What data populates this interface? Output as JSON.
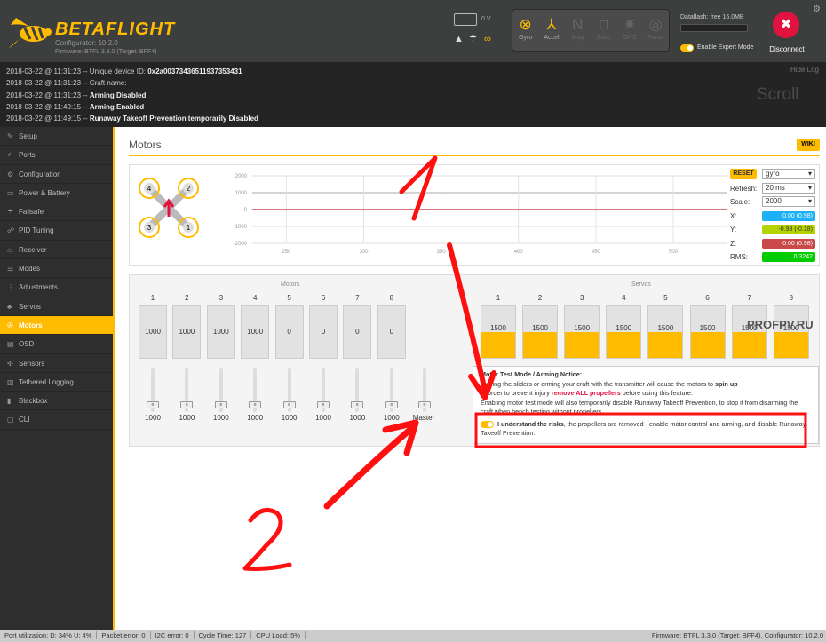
{
  "header": {
    "brand": "BETAFLIGHT",
    "configurator": "Configurator: 10.2.0",
    "firmware": "Firmware: BTFL 3.3.0 (Target: BFF4)",
    "battery_voltage": "0 V",
    "sensors": [
      {
        "label": "Gyro",
        "icon": "gyro-icon",
        "active": true
      },
      {
        "label": "Accel",
        "icon": "accel-icon",
        "active": true
      },
      {
        "label": "Mag",
        "icon": "mag-icon",
        "active": false
      },
      {
        "label": "Baro",
        "icon": "baro-icon",
        "active": false
      },
      {
        "label": "GPS",
        "icon": "gps-icon",
        "active": false
      },
      {
        "label": "Sonar",
        "icon": "sonar-icon",
        "active": false
      }
    ],
    "dataflash": "Dataflash: free 16.0MB",
    "expert_mode": "Enable Expert Mode",
    "disconnect": "Disconnect"
  },
  "log": {
    "hide": "Hide Log",
    "scroll": "Scroll",
    "lines": [
      {
        "prefix": "2018-03-22 @ 11:31:23 -- Unique device ID: ",
        "bold": "0x2a00373436511937353431"
      },
      {
        "prefix": "2018-03-22 @ 11:31:23 -- Craft name:",
        "bold": ""
      },
      {
        "prefix": "2018-03-22 @ 11:31:23 -- ",
        "bold": "Arming Disabled"
      },
      {
        "prefix": "2018-03-22 @ 11:49:15 -- ",
        "bold": "Arming Enabled"
      },
      {
        "prefix": "2018-03-22 @ 11:49:15 -- ",
        "bold": "Runaway Takeoff Prevention temporarily Disabled"
      }
    ]
  },
  "sidebar": {
    "items": [
      {
        "label": "Setup",
        "icon": "wrench-icon",
        "glyph": "✎"
      },
      {
        "label": "Ports",
        "icon": "plug-icon",
        "glyph": "⚡"
      },
      {
        "label": "Configuration",
        "icon": "gear-icon",
        "glyph": "⚙"
      },
      {
        "label": "Power & Battery",
        "icon": "battery-icon",
        "glyph": "▭"
      },
      {
        "label": "Failsafe",
        "icon": "failsafe-icon",
        "glyph": "☂"
      },
      {
        "label": "PID Tuning",
        "icon": "pid-icon",
        "glyph": "☍"
      },
      {
        "label": "Receiver",
        "icon": "receiver-icon",
        "glyph": "⌂"
      },
      {
        "label": "Modes",
        "icon": "modes-icon",
        "glyph": "☰"
      },
      {
        "label": "Adjustments",
        "icon": "adjustments-icon",
        "glyph": "⋮"
      },
      {
        "label": "Servos",
        "icon": "servo-icon",
        "glyph": "♣"
      },
      {
        "label": "Motors",
        "icon": "motor-icon",
        "glyph": "✇",
        "active": true
      },
      {
        "label": "OSD",
        "icon": "osd-icon",
        "glyph": "▤"
      },
      {
        "label": "Sensors",
        "icon": "sensors-icon",
        "glyph": "✣"
      },
      {
        "label": "Tethered Logging",
        "icon": "tethered-icon",
        "glyph": "▥"
      },
      {
        "label": "Blackbox",
        "icon": "blackbox-icon",
        "glyph": "▮"
      },
      {
        "label": "CLI",
        "icon": "cli-icon",
        "glyph": "▢"
      }
    ]
  },
  "main": {
    "title": "Motors",
    "wiki": "WIKI",
    "quad_motors": [
      "4",
      "2",
      "3",
      "1"
    ],
    "graph": {
      "y_ticks": [
        "2000",
        "1000",
        "0",
        "-1000",
        "-2000"
      ],
      "x_ticks": [
        "250",
        "300",
        "350",
        "400",
        "450",
        "500"
      ],
      "x_values": [
        250,
        300,
        350,
        400,
        450,
        500
      ],
      "x_range": [
        228,
        535
      ],
      "y_range": [
        -2000,
        2000
      ]
    },
    "controls": {
      "reset": "RESET",
      "sensor": "gyro",
      "refresh_label": "Refresh:",
      "refresh": "20 ms",
      "scale_label": "Scale:",
      "scale": "2000",
      "x_label": "X:",
      "x_value": "0.00 (0.98)",
      "y_label": "Y:",
      "y_value": "-0.98 (-0.18)",
      "z_label": "Z:",
      "z_value": "0.00 (0.98)",
      "rms_label": "RMS:",
      "rms_value": "0.3242",
      "colors": {
        "x": "#1cb0f6",
        "y": "#b5d300",
        "z": "#c94848",
        "rms": "#00cc00"
      }
    },
    "motors_label": "Motors",
    "servos_label": "Servos",
    "motors": [
      {
        "ch": "1",
        "value": "1000"
      },
      {
        "ch": "2",
        "value": "1000"
      },
      {
        "ch": "3",
        "value": "1000"
      },
      {
        "ch": "4",
        "value": "1000"
      },
      {
        "ch": "5",
        "value": "0"
      },
      {
        "ch": "6",
        "value": "0"
      },
      {
        "ch": "7",
        "value": "0"
      },
      {
        "ch": "8",
        "value": "0"
      }
    ],
    "servos": [
      {
        "ch": "1",
        "value": "1500",
        "level": 0.5
      },
      {
        "ch": "2",
        "value": "1500",
        "level": 0.5
      },
      {
        "ch": "3",
        "value": "1500",
        "level": 0.5
      },
      {
        "ch": "4",
        "value": "1500",
        "level": 0.5
      },
      {
        "ch": "5",
        "value": "1500",
        "level": 0.5
      },
      {
        "ch": "6",
        "value": "1500",
        "level": 0.5
      },
      {
        "ch": "7",
        "value": "1500",
        "level": 0.5
      },
      {
        "ch": "8",
        "value": "1500",
        "level": 0.5
      }
    ],
    "slider_values": [
      "1000",
      "1000",
      "1000",
      "1000",
      "1000",
      "1000",
      "1000",
      "1000"
    ],
    "master": "Master",
    "notice": {
      "title": "Motor Test Mode / Arming Notice:",
      "l1a": "Moving the sliders or arming your craft with the transmitter will cause the motors to ",
      "l1b": "spin up",
      "l2a": "In order to prevent injury ",
      "l2b": "remove ALL propellers",
      "l2c": " before using this feature.",
      "l3": "Enabling motor test mode will also temporarily disable Runaway Takeoff Prevention, to stop it from disarming the craft when bench testing without propellers.",
      "understand_bold": "I understand the risks",
      "understand_rest": ", the propellers are removed - enable motor control and arming, and disable Runaway Takeoff Prevention."
    }
  },
  "watermark": "PROFPV.RU",
  "annotations": {
    "one": "1",
    "two": "2"
  },
  "status": {
    "port": "Port utilization: D: 34% U: 4%",
    "packet": "Packet error: 0",
    "i2c": "I2C error: 0",
    "cycle": "Cycle Time: 127",
    "cpu": "CPU Load: 5%",
    "firmware": "Firmware: BTFL 3.3.0 (Target: BFF4), Configurator: 10.2.0"
  }
}
